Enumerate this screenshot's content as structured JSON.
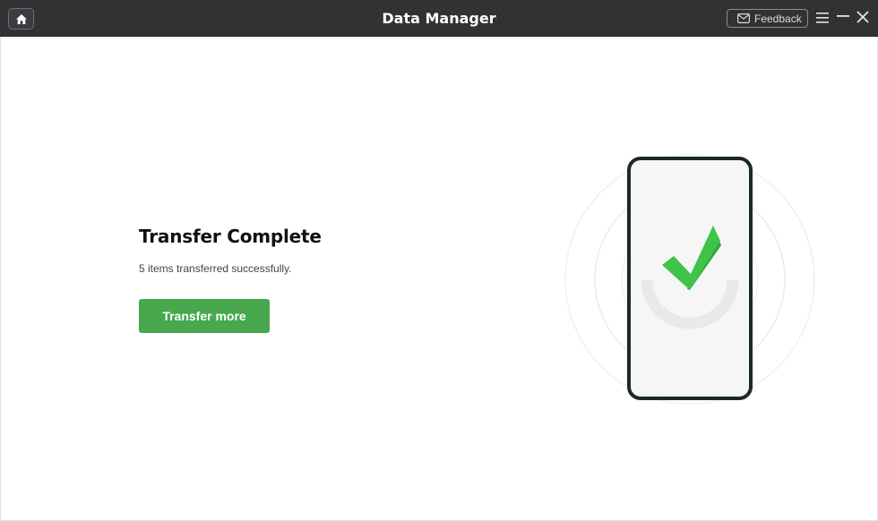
{
  "header": {
    "title": "Data Manager",
    "feedback_label": "Feedback",
    "icons": [
      "home-icon",
      "mail-icon",
      "menu-icon",
      "minimize-icon",
      "close-icon"
    ]
  },
  "result": {
    "title": "Transfer Complete",
    "subtitle": "5 items transferred successfully.",
    "button_label": "Transfer more"
  },
  "illustration": {
    "icons": [
      "phone-icon",
      "checkmark-icon"
    ]
  },
  "colors": {
    "titlebar": "#2f3133",
    "accent_green": "#47a84e",
    "check_green": "#35b33f",
    "phone_frame": "#1d2a1f"
  }
}
